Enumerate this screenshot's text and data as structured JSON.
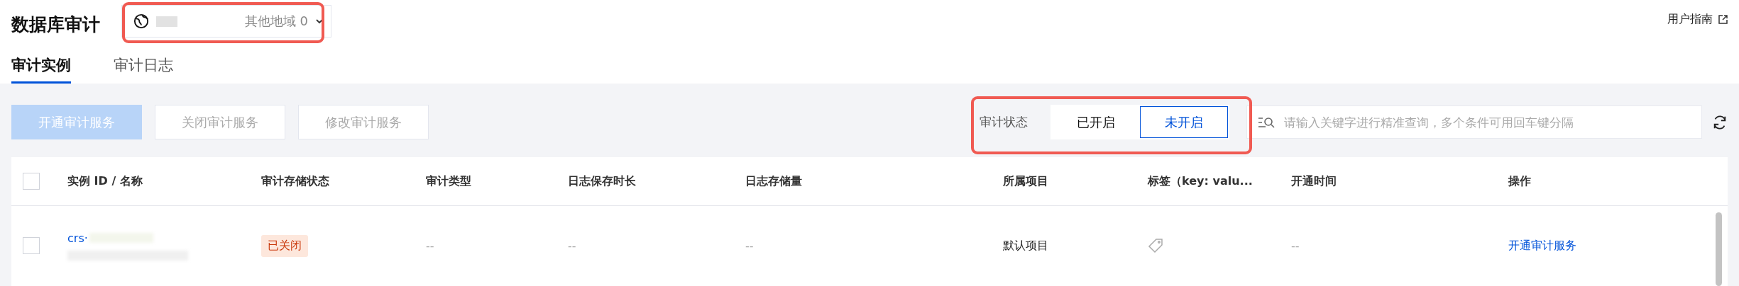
{
  "page_title": "数据库审计",
  "region_selector": {
    "value": "其他地域 0"
  },
  "help_link": "用户指南",
  "tabs": [
    {
      "label": "审计实例",
      "selected": true
    },
    {
      "label": "审计日志",
      "selected": false
    }
  ],
  "toolbar": {
    "buttons": [
      {
        "label": "开通审计服务",
        "kind": "primary",
        "disabled": true
      },
      {
        "label": "关闭审计服务",
        "kind": "default",
        "disabled": true
      },
      {
        "label": "修改审计服务",
        "kind": "default",
        "disabled": true
      }
    ],
    "status_filter": {
      "label": "审计状态",
      "options": [
        {
          "label": "已开启",
          "selected": false
        },
        {
          "label": "未开启",
          "selected": true
        }
      ]
    },
    "search": {
      "placeholder": "请输入关键字进行精准查询，多个条件可用回车键分隔"
    }
  },
  "table": {
    "header_checked": false,
    "columns": [
      "实例 ID / 名称",
      "审计存储状态",
      "审计类型",
      "日志保存时长",
      "日志存储量",
      "所属项目",
      "标签（key: valu...",
      "开通时间",
      "操作"
    ],
    "rows": [
      {
        "checked": false,
        "instance_id": "crs·",
        "storage_status": "已关闭",
        "audit_type": "--",
        "retention": "--",
        "storage": "--",
        "project": "默认项目",
        "open_time": "--",
        "action": "开通审计服务"
      }
    ]
  }
}
